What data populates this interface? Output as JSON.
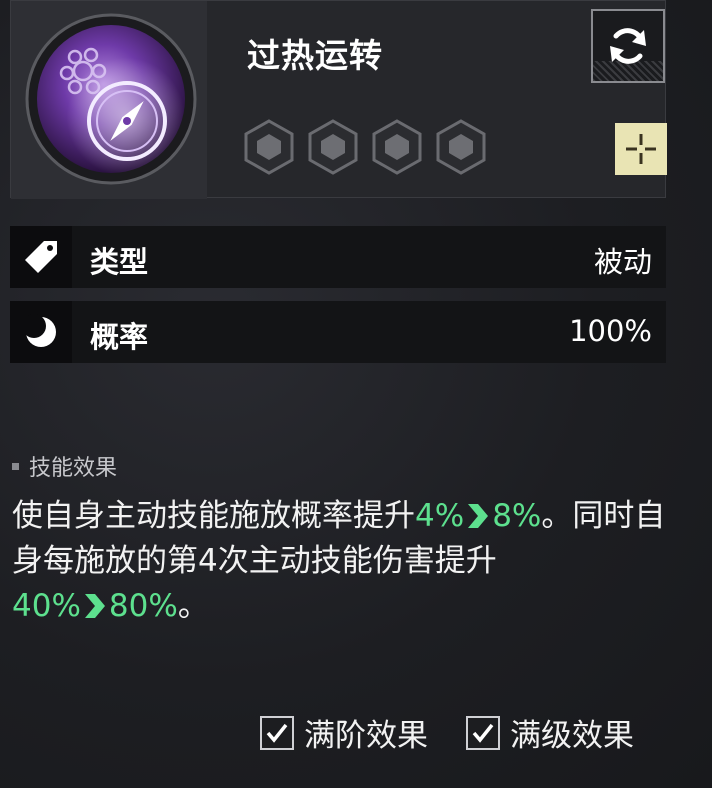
{
  "skill": {
    "name": "过热运转",
    "icon": "compass-gear-icon",
    "gem_slots": 4,
    "refresh_icon": "refresh-icon",
    "add_icon": "crosshair-plus-icon"
  },
  "stats": {
    "type": {
      "icon": "tag-icon",
      "label": "类型",
      "value": "被动"
    },
    "chance": {
      "icon": "moon-icon",
      "label": "概率",
      "value": "100%"
    }
  },
  "effect": {
    "title": "技能效果",
    "line1_prefix": "使自身主动技能施放概率提升",
    "line1_from": "4%",
    "line1_to": "8%",
    "line1_suffix": "。同时自身每施放的第4次主动技能伤害提升",
    "line2_from": "40%",
    "line2_to": "80%",
    "line2_suffix": "。"
  },
  "toggles": {
    "full_rank": {
      "label": "满阶效果",
      "checked": true
    },
    "full_level": {
      "label": "满级效果",
      "checked": true
    }
  },
  "colors": {
    "highlight": "#5de08e",
    "add_button": "#e9e4b4",
    "icon_purple": "#9a5fd0"
  }
}
